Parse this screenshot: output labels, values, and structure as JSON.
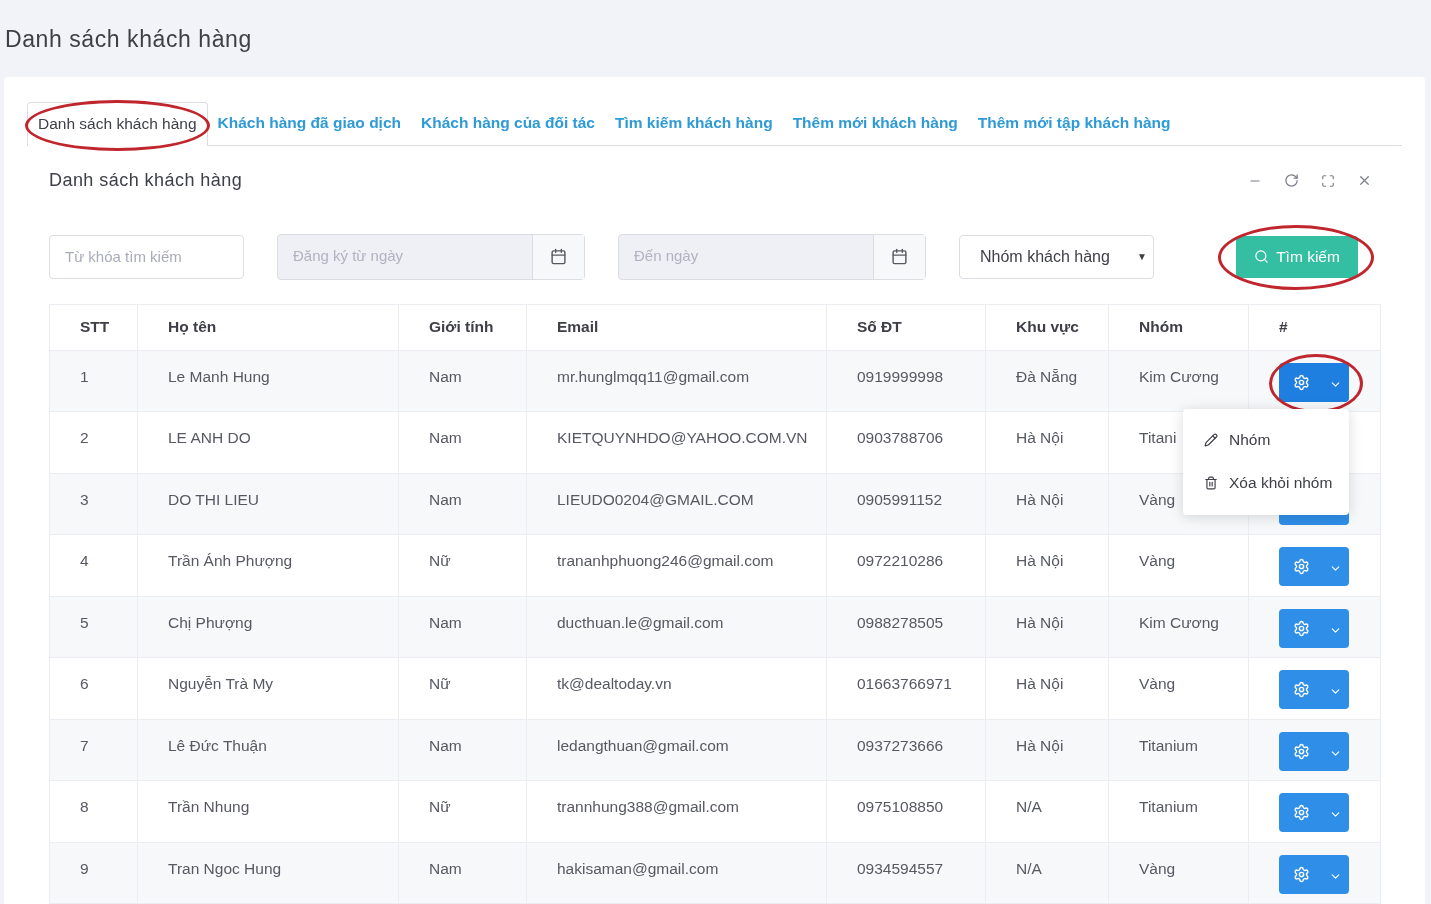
{
  "page_title": "Danh sách khách hàng",
  "tabs": [
    {
      "label": "Danh sách khách hàng",
      "selected": true,
      "circled": true
    },
    {
      "label": "Khách hàng đã giao dịch",
      "selected": false,
      "circled": false
    },
    {
      "label": "Khách hàng của đối tác",
      "selected": false,
      "circled": false
    },
    {
      "label": "Tìm kiếm khách hàng",
      "selected": false,
      "circled": false
    },
    {
      "label": "Thêm mới khách hàng",
      "selected": false,
      "circled": false
    },
    {
      "label": "Thêm mới tập khách hàng",
      "selected": false,
      "circled": false
    }
  ],
  "panel": {
    "title": "Danh sách khách hàng"
  },
  "filters": {
    "keyword": {
      "placeholder": "Từ khóa tìm kiếm"
    },
    "date_from": {
      "placeholder": "Đăng ký từ ngày"
    },
    "date_to": {
      "placeholder": "Đến ngày"
    },
    "group_select": {
      "value": "Nhóm khách hàng",
      "caret": "▼"
    },
    "search_button": {
      "label": "Tìm kiếm",
      "circled": true
    }
  },
  "table": {
    "columns": [
      "STT",
      "Họ tên",
      "Giới tính",
      "Email",
      "Số ĐT",
      "Khu vực",
      "Nhóm",
      "#"
    ],
    "rows": [
      {
        "cells": [
          "1",
          "Le Manh Hung",
          "Nam",
          "mr.hunglmqq11@gmail.com",
          "0919999998",
          "Đà Nẵng",
          "Kim Cương"
        ],
        "circled": true,
        "menu": [
          {
            "kind": "edit",
            "label": "Nhóm"
          },
          {
            "kind": "delete",
            "label": "Xóa khỏi nhóm"
          }
        ]
      },
      {
        "cells": [
          "2",
          "LE ANH DO",
          "Nam",
          "KIETQUYNHDO@YAHOO.COM.VN",
          "0903788706",
          "Hà Nội",
          "Titani"
        ],
        "circled": false
      },
      {
        "cells": [
          "3",
          "DO THI LIEU",
          "Nam",
          "LIEUDO0204@GMAIL.COM",
          "0905991152",
          "Hà Nội",
          "Vàng"
        ],
        "circled": false
      },
      {
        "cells": [
          "4",
          "Trần Ánh Phượng",
          "Nữ",
          "trananhphuong246@gmail.com",
          "0972210286",
          "Hà Nội",
          "Vàng"
        ],
        "circled": false
      },
      {
        "cells": [
          "5",
          "Chị Phượng",
          "Nam",
          "ducthuan.le@gmail.com",
          "0988278505",
          "Hà Nội",
          "Kim Cương"
        ],
        "circled": false
      },
      {
        "cells": [
          "6",
          "Nguyễn Trà My",
          "Nữ",
          "tk@dealtoday.vn",
          "01663766971",
          "Hà Nội",
          "Vàng"
        ],
        "circled": false
      },
      {
        "cells": [
          "7",
          "Lê Đức Thuận",
          "Nam",
          "ledangthuan@gmail.com",
          "0937273666",
          "Hà Nội",
          "Titanium"
        ],
        "circled": false
      },
      {
        "cells": [
          "8",
          "Trần Nhung",
          "Nữ",
          "trannhung388@gmail.com",
          "0975108850",
          "N/A",
          "Titanium"
        ],
        "circled": false
      },
      {
        "cells": [
          "9",
          "Tran Ngoc Hung",
          "Nam",
          "hakisaman@gmail.com",
          "0934594557",
          "N/A",
          "Vàng"
        ],
        "circled": false
      }
    ]
  }
}
